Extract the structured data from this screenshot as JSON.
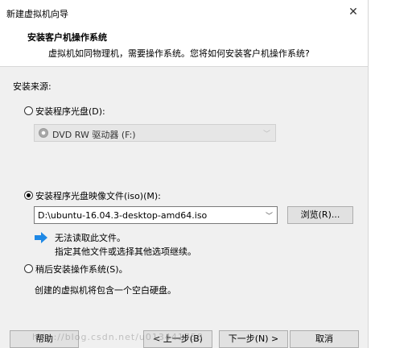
{
  "window": {
    "title": "新建虚拟机向导"
  },
  "header": {
    "title": "安装客户机操作系统",
    "subtitle": "虚拟机如同物理机，需要操作系统。您将如何安装客户机操作系统?"
  },
  "source": {
    "label": "安装来源:",
    "disc_option": {
      "label": "安装程序光盘(D):",
      "selected": false
    },
    "disc_drive": {
      "value": "DVD RW 驱动器 (F:)",
      "enabled": false
    },
    "iso_option": {
      "label": "安装程序光盘映像文件(iso)(M):",
      "selected": true
    },
    "iso_path": {
      "value": "D:\\ubuntu-16.04.3-desktop-amd64.iso"
    },
    "browse_label": "浏览(R)...",
    "warning_line1": "无法读取此文件。",
    "warning_line2": "指定其他文件或选择其他选项继续。",
    "later_option": {
      "label": "稍后安装操作系统(S)。",
      "selected": false
    },
    "later_desc": "创建的虚拟机将包含一个空白硬盘。"
  },
  "footer": {
    "help_label": "帮助",
    "back_label": "< 上一步(B)",
    "next_label": "下一步(N) >",
    "cancel_label": "取消"
  },
  "watermark": "http://blog.csdn.net/u013441758",
  "colors": {
    "accent_arrow": "#1e88e5",
    "dialog_bg": "#f0f0f0"
  },
  "icons": {
    "close": "close-icon",
    "disc": "disc-icon",
    "dropdown": "chevron-down-icon",
    "info_arrow": "arrow-right-icon"
  }
}
